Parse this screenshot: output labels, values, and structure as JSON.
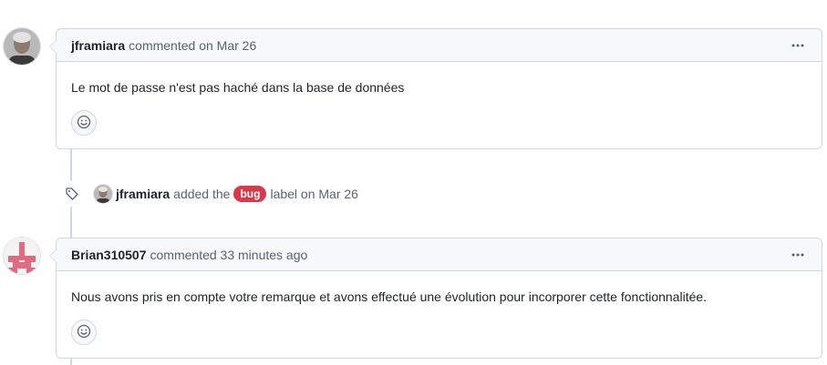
{
  "timeline": {
    "comment1": {
      "author": "jframiara",
      "meta": "commented on Mar 26",
      "body": "Le mot de passe n'est pas haché dans la base de données"
    },
    "label_event": {
      "actor": "jframiara",
      "action": "added the",
      "label": "bug",
      "label_color": "#d73a4a",
      "suffix": "label on Mar 26"
    },
    "comment2": {
      "author": "Brian310507",
      "meta": "commented 33 minutes ago",
      "body": "Nous avons pris en compte votre remarque et avons effectué une évolution pour incorporer cette fonctionnalitée."
    }
  },
  "icons": {
    "kebab": "kebab-horizontal-icon",
    "reaction": "smiley-icon",
    "label_event": "tag-icon"
  }
}
